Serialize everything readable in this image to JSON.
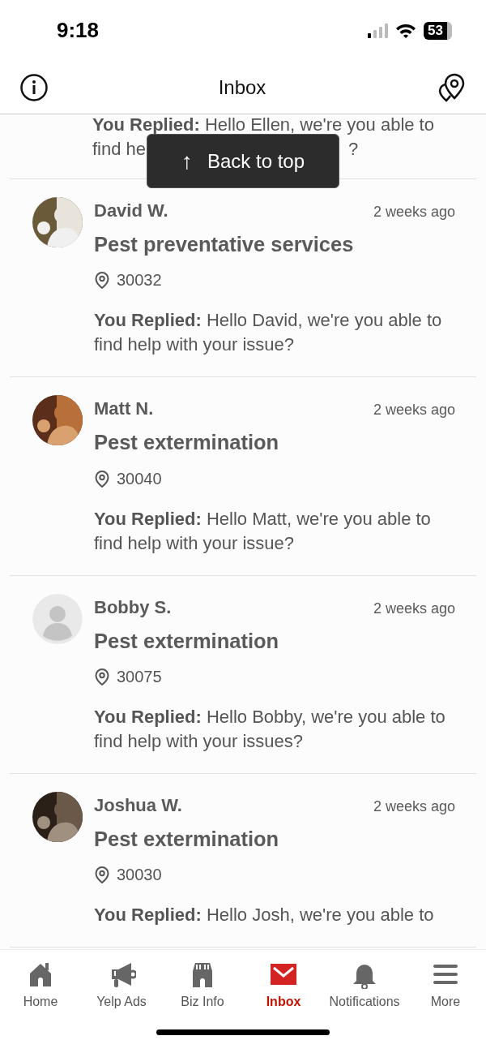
{
  "status_bar": {
    "time": "9:18",
    "battery": "53"
  },
  "header": {
    "title": "Inbox"
  },
  "toast": {
    "icon": "↑",
    "label": "Back to top"
  },
  "partial_message": {
    "reply_label": "You Replied:",
    "reply_line_1": "Hello Ellen, we're you able to",
    "reply_line_2": "find he",
    "reply_tail": "?"
  },
  "messages": [
    {
      "name": "David W.",
      "time": "2 weeks ago",
      "service": "Pest preventative services",
      "zip": "30032",
      "reply_label": "You Replied:",
      "reply": "Hello David, we're you able to find help with your issue?"
    },
    {
      "name": "Matt N.",
      "time": "2 weeks ago",
      "service": "Pest extermination",
      "zip": "30040",
      "reply_label": "You Replied:",
      "reply": "Hello Matt, we're you able to find help with your issue?"
    },
    {
      "name": "Bobby S.",
      "time": "2 weeks ago",
      "service": "Pest extermination",
      "zip": "30075",
      "kind": "placeholder",
      "reply_label": "You Replied:",
      "reply": "Hello Bobby, we're you able to find help with your issues?"
    },
    {
      "name": "Joshua W.",
      "time": "2 weeks ago",
      "service": "Pest extermination",
      "zip": "30030",
      "reply_label": "You Replied:",
      "reply": "Hello Josh, we're you able to"
    }
  ],
  "tab_bar": [
    {
      "kind": "home",
      "label": "Home",
      "selected": false
    },
    {
      "kind": "ads",
      "label": "Yelp Ads",
      "selected": false
    },
    {
      "kind": "biz",
      "label": "Biz Info",
      "selected": false
    },
    {
      "kind": "inbox",
      "label": "Inbox",
      "selected": true
    },
    {
      "kind": "bell",
      "label": "Notifications",
      "selected": false
    },
    {
      "kind": "more",
      "label": "More",
      "selected": false
    }
  ]
}
